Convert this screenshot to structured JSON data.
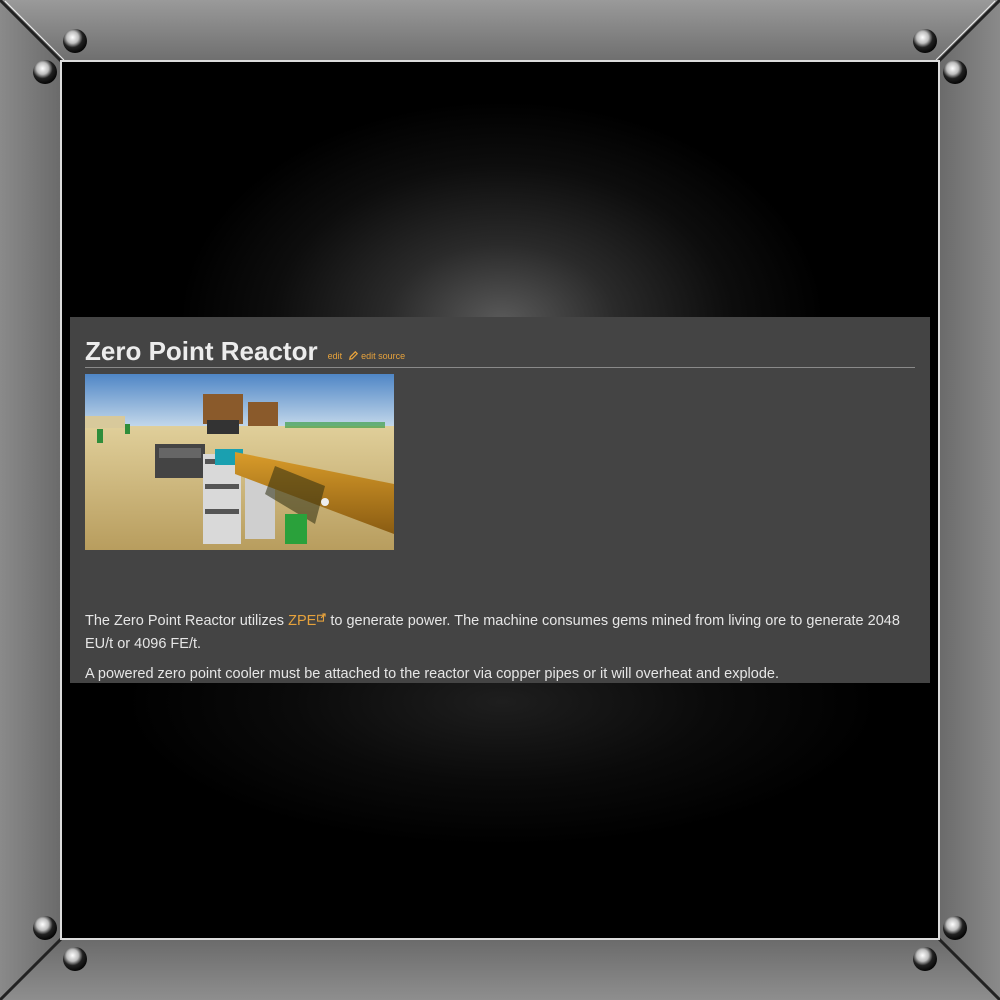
{
  "article": {
    "title": "Zero Point Reactor",
    "edit_label": "edit",
    "edit_source_label": "edit source",
    "image_alt": "Zero Point Reactor in a desert world",
    "paragraph1": {
      "before": "The Zero Point Reactor utilizes ",
      "link": "ZPE",
      "after": " to generate power. The machine consumes gems mined from living ore to generate 2048 EU/t or 4096 FE/t."
    },
    "paragraph2": "A powered zero point cooler must be attached to the reactor via copper pipes or it will overheat and explode."
  },
  "colors": {
    "panel_bg": "#444444",
    "link": "#e6a23c",
    "text": "#e6e6e6",
    "frame": "#7d7d7d"
  },
  "icons": {
    "pencil": "pencil-icon",
    "external_link": "external-link-icon",
    "screw": "screw-icon"
  }
}
